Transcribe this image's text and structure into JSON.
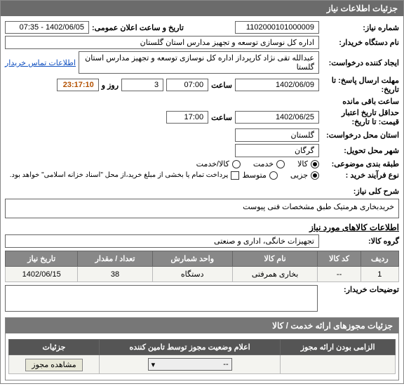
{
  "panel": {
    "title": "جزئیات اطلاعات نیاز"
  },
  "labels": {
    "need_no": "شماره نیاز:",
    "pub_datetime": "تاریخ و ساعت اعلان عمومی:",
    "buyer_org": "نام دستگاه خریدار:",
    "requester": "ایجاد کننده درخواست:",
    "contact_link": "اطلاعات تماس خریدار",
    "deadline_to": "مهلت ارسال پاسخ: تا\nتاریخ:",
    "saat": "ساعت",
    "rooz_va": "روز و",
    "remaining": "ساعت باقی مانده",
    "validity_to": "حداقل تاریخ اعتبار\nقیمت: تا تاریخ:",
    "req_province": "استان محل درخواست:",
    "deliver_city": "شهر محل تحویل:",
    "category": "طبقه بندی موضوعی:",
    "cat_goods": "کالا",
    "cat_service": "خدمت",
    "cat_both": "کالا/خدمت",
    "buy_type": "نوع فرآیند خرید :",
    "bt_small": "جزیی",
    "bt_medium": "متوسط",
    "bt_note": "پرداخت تمام یا بخشی از مبلغ خرید،از محل \"اسناد خزانه اسلامی\" خواهد بود.",
    "need_desc": "شرح کلی نیاز:",
    "goods_info": "اطلاعات کالاهای مورد نیاز",
    "goods_group": "گروه کالا:",
    "buyer_notes": "توضیحات خریدار:"
  },
  "fields": {
    "need_no": "1102000101000009",
    "pub_datetime": "1402/06/05 - 07:35",
    "buyer_org": "اداره کل نوسازی  توسعه و تجهیز مدارس استان گلستان",
    "requester": "عبدالله تقی نژاد کارپرداز اداره کل نوسازی  توسعه و تجهیز مدارس استان گلستا",
    "deadline_date": "1402/06/09",
    "deadline_time": "07:00",
    "days_left": "3",
    "time_left": "23:17:10",
    "validity_date": "1402/06/25",
    "validity_time": "17:00",
    "province": "گلستان",
    "city": "گرگان",
    "need_desc": "خریدبخاری هرمتیک طبق مشخصات فنی پیوست",
    "goods_group": "تجهیزات خانگی، اداری و صنعتی"
  },
  "goods_table": {
    "headers": [
      "ردیف",
      "کد کالا",
      "نام کالا",
      "واحد شمارش",
      "تعداد / مقدار",
      "تاریخ نیاز"
    ],
    "rows": [
      {
        "no": "1",
        "code": "--",
        "name": "بخاری همرفتی",
        "unit": "دستگاه",
        "qty": "38",
        "date": "1402/06/15"
      }
    ]
  },
  "license_panel": {
    "title": "جزئیات مجوزهای ارائه خدمت / کالا",
    "headers": [
      "الزامی بودن ارائه مجوز",
      "اعلام وضعیت مجوز توسط تامین کننده",
      "جزئیات"
    ],
    "row": {
      "mandatory": "",
      "status_sel": "--",
      "detail_btn": "مشاهده مجوز"
    }
  }
}
